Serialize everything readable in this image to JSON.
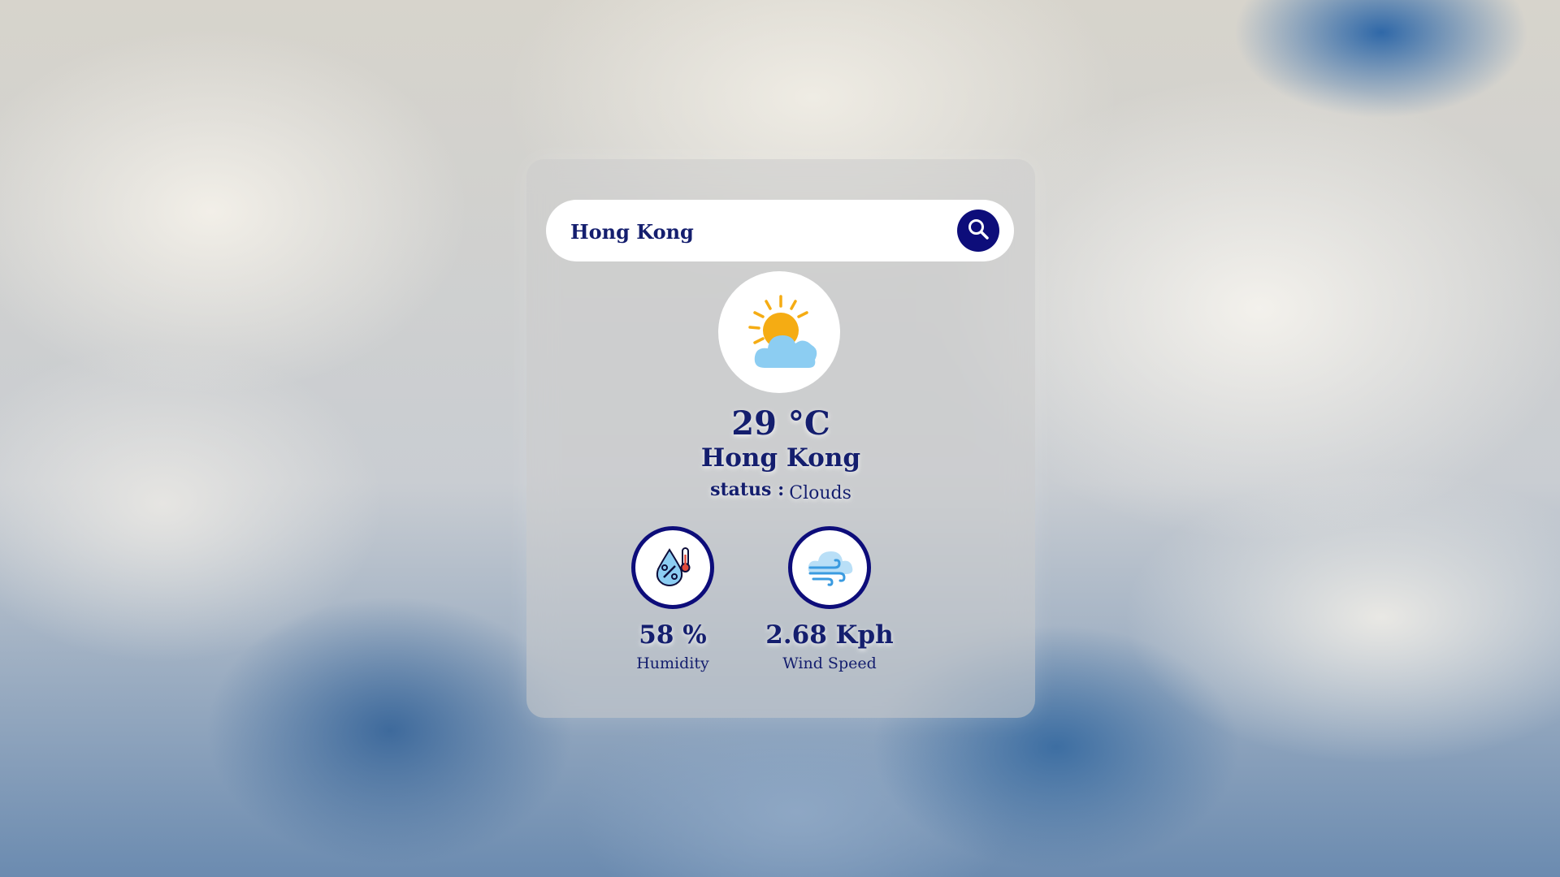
{
  "search": {
    "value": "Hong Kong",
    "button_icon": "search-icon"
  },
  "weather": {
    "icon": "partly-cloudy-icon",
    "temperature": "29 °C",
    "city": "Hong Kong",
    "status_label": "status :",
    "status_value": "Clouds"
  },
  "stats": {
    "humidity": {
      "icon": "humidity-icon",
      "value": "58 %",
      "label": "Humidity"
    },
    "wind": {
      "icon": "wind-icon",
      "value": "2.68 Kph",
      "label": "Wind Speed"
    }
  },
  "colors": {
    "accent": "#0d0d7a",
    "text": "#141e6e",
    "sun": "#f5ac13",
    "cloud": "#8ccdf2"
  }
}
